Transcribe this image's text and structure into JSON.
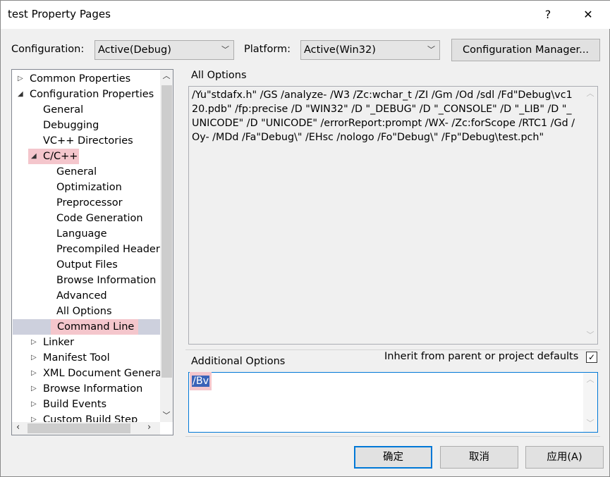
{
  "window": {
    "title": "test Property Pages",
    "help": "?",
    "close": "✕"
  },
  "config": {
    "label": "Configuration:",
    "value": "Active(Debug)",
    "platform_label": "Platform:",
    "platform_value": "Active(Win32)",
    "manager_button": "Configuration Manager..."
  },
  "tree": [
    {
      "label": "Common Properties",
      "level": 0,
      "arrow": "▷"
    },
    {
      "label": "Configuration Properties",
      "level": 0,
      "arrow": "◢"
    },
    {
      "label": "General",
      "level": 1,
      "arrow": ""
    },
    {
      "label": "Debugging",
      "level": 1,
      "arrow": ""
    },
    {
      "label": "VC++ Directories",
      "level": 1,
      "arrow": ""
    },
    {
      "label": "C/C++",
      "level": 1,
      "arrow": "◢",
      "highlight": true
    },
    {
      "label": "General",
      "level": 2,
      "arrow": ""
    },
    {
      "label": "Optimization",
      "level": 2,
      "arrow": ""
    },
    {
      "label": "Preprocessor",
      "level": 2,
      "arrow": ""
    },
    {
      "label": "Code Generation",
      "level": 2,
      "arrow": ""
    },
    {
      "label": "Language",
      "level": 2,
      "arrow": ""
    },
    {
      "label": "Precompiled Headers",
      "level": 2,
      "arrow": ""
    },
    {
      "label": "Output Files",
      "level": 2,
      "arrow": ""
    },
    {
      "label": "Browse Information",
      "level": 2,
      "arrow": ""
    },
    {
      "label": "Advanced",
      "level": 2,
      "arrow": ""
    },
    {
      "label": "All Options",
      "level": 2,
      "arrow": ""
    },
    {
      "label": "Command Line",
      "level": 2,
      "arrow": "",
      "selected": true,
      "highlight": true
    },
    {
      "label": "Linker",
      "level": 1,
      "arrow": "▷"
    },
    {
      "label": "Manifest Tool",
      "level": 1,
      "arrow": "▷"
    },
    {
      "label": "XML Document Generator",
      "level": 1,
      "arrow": "▷"
    },
    {
      "label": "Browse Information",
      "level": 1,
      "arrow": "▷"
    },
    {
      "label": "Build Events",
      "level": 1,
      "arrow": "▷"
    },
    {
      "label": "Custom Build Step",
      "level": 1,
      "arrow": "▷"
    }
  ],
  "all_options": {
    "label": "All Options",
    "text": "/Yu\"stdafx.h\" /GS /analyze- /W3 /Zc:wchar_t /ZI /Gm /Od /sdl /Fd\"Debug\\vc120.pdb\" /fp:precise /D \"WIN32\" /D \"_DEBUG\" /D \"_CONSOLE\" /D \"_LIB\" /D \"_UNICODE\" /D \"UNICODE\" /errorReport:prompt /WX- /Zc:forScope /RTC1 /Gd /Oy- /MDd /Fa\"Debug\\\" /EHsc /nologo /Fo\"Debug\\\" /Fp\"Debug\\test.pch\""
  },
  "additional": {
    "label": "Additional Options",
    "inherit_label": "Inherit from parent or project defaults",
    "inherit_checked": true,
    "value": "/Bv"
  },
  "buttons": {
    "ok": "确定",
    "cancel": "取消",
    "apply": "应用(A)"
  },
  "colors": {
    "accent": "#0078d7",
    "highlight": "#f4c6cc",
    "selection": "#cdd0dd",
    "selected_text_bg": "#3a63b8"
  }
}
